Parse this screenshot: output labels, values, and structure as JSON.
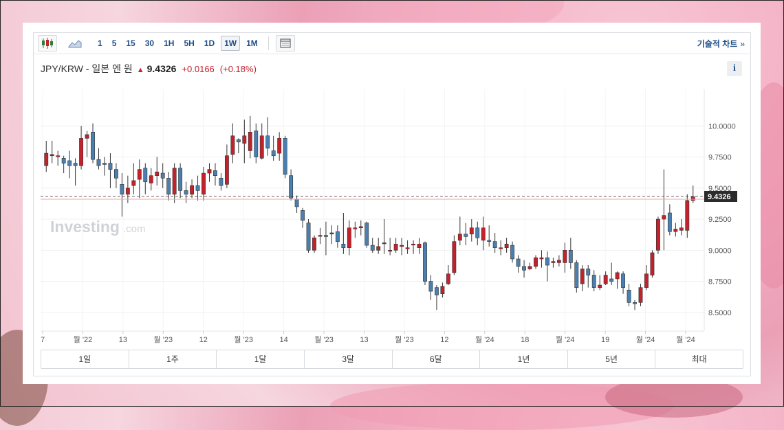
{
  "toolbar": {
    "timeframes": [
      "1",
      "5",
      "15",
      "30",
      "1H",
      "5H",
      "1D",
      "1W",
      "1M"
    ],
    "active_timeframe": "1W",
    "technical_chart_label": "기술적 차트",
    "technical_chart_chevron": "»",
    "icons": [
      "candlestick-icon",
      "area-chart-icon",
      "layout-icon"
    ]
  },
  "quote": {
    "name": "JPY/KRW - 일본 엔 원",
    "direction": "up",
    "price": "9.4326",
    "change": "+0.0166",
    "change_pct": "(+0.18%)"
  },
  "info_label": "i",
  "watermark": {
    "brand": "Investing",
    "suffix": ".com"
  },
  "ranges": [
    "1일",
    "1주",
    "1달",
    "3달",
    "6달",
    "1년",
    "5년",
    "최대"
  ],
  "colors": {
    "up": "#c3212b",
    "down": "#4a7fb0",
    "accent": "#1d4e89",
    "current_price_tag": "#2b2b2b"
  },
  "chart_data": {
    "type": "candlestick",
    "y_ticks": [
      "10.0000",
      "9.7500",
      "9.5000",
      "9.2500",
      "9.0000",
      "8.7500",
      "8.5000"
    ],
    "ylim": [
      8.35,
      10.25
    ],
    "current_price": "9.4326",
    "x_ticks": [
      "7",
      "월 '22",
      "13",
      "월 '23",
      "12",
      "월 '23",
      "14",
      "월 '23",
      "13",
      "월 '23",
      "12",
      "월 '24",
      "18",
      "월 '24",
      "19",
      "월 '24",
      "월 '24"
    ],
    "candles": [
      [
        9.68,
        9.78,
        9.88,
        9.63
      ],
      [
        9.76,
        9.77,
        9.88,
        9.7
      ],
      [
        9.76,
        9.76,
        9.8,
        9.68
      ],
      [
        9.74,
        9.7,
        9.76,
        9.62
      ],
      [
        9.72,
        9.68,
        9.8,
        9.58
      ],
      [
        9.7,
        9.68,
        9.74,
        9.52
      ],
      [
        9.68,
        9.9,
        10.0,
        9.65
      ],
      [
        9.9,
        9.93,
        9.96,
        9.75
      ],
      [
        9.95,
        9.73,
        10.02,
        9.7
      ],
      [
        9.73,
        9.68,
        9.82,
        9.65
      ],
      [
        9.7,
        9.69,
        9.75,
        9.6
      ],
      [
        9.7,
        9.65,
        9.78,
        9.5
      ],
      [
        9.65,
        9.58,
        9.7,
        9.5
      ],
      [
        9.53,
        9.45,
        9.62,
        9.27
      ],
      [
        9.45,
        9.5,
        9.6,
        9.38
      ],
      [
        9.52,
        9.56,
        9.7,
        9.45
      ],
      [
        9.57,
        9.65,
        9.73,
        9.42
      ],
      [
        9.66,
        9.55,
        9.7,
        9.45
      ],
      [
        9.54,
        9.6,
        9.66,
        9.48
      ],
      [
        9.6,
        9.63,
        9.75,
        9.52
      ],
      [
        9.62,
        9.58,
        9.7,
        9.5
      ],
      [
        9.58,
        9.45,
        9.63,
        9.4
      ],
      [
        9.45,
        9.66,
        9.7,
        9.38
      ],
      [
        9.66,
        9.48,
        9.7,
        9.42
      ],
      [
        9.48,
        9.45,
        9.55,
        9.38
      ],
      [
        9.45,
        9.52,
        9.57,
        9.42
      ],
      [
        9.52,
        9.48,
        9.6,
        9.4
      ],
      [
        9.45,
        9.62,
        9.67,
        9.4
      ],
      [
        9.62,
        9.65,
        9.7,
        9.55
      ],
      [
        9.64,
        9.6,
        9.7,
        9.52
      ],
      [
        9.58,
        9.52,
        9.62,
        9.48
      ],
      [
        9.53,
        9.76,
        9.85,
        9.5
      ],
      [
        9.77,
        9.92,
        10.02,
        9.7
      ],
      [
        9.89,
        9.87,
        9.9,
        9.78
      ],
      [
        9.86,
        9.92,
        10.05,
        9.7
      ],
      [
        9.8,
        9.95,
        10.08,
        9.74
      ],
      [
        9.96,
        9.75,
        10.02,
        9.7
      ],
      [
        9.74,
        9.92,
        10.02,
        9.73
      ],
      [
        9.92,
        9.82,
        10.07,
        9.76
      ],
      [
        9.8,
        9.76,
        9.92,
        9.72
      ],
      [
        9.78,
        9.9,
        9.95,
        9.72
      ],
      [
        9.9,
        9.61,
        9.92,
        9.58
      ],
      [
        9.6,
        9.42,
        9.65,
        9.4
      ],
      [
        9.41,
        9.35,
        9.44,
        9.3
      ],
      [
        9.32,
        9.24,
        9.34,
        9.18
      ],
      [
        9.22,
        9.0,
        9.25,
        8.98
      ],
      [
        9.0,
        9.1,
        9.12,
        8.98
      ],
      [
        9.12,
        9.12,
        9.18,
        9.05
      ],
      [
        9.12,
        9.11,
        9.23,
        8.96
      ],
      [
        9.13,
        9.14,
        9.2,
        9.05
      ],
      [
        9.15,
        9.07,
        9.2,
        9.02
      ],
      [
        9.05,
        9.02,
        9.3,
        8.97
      ],
      [
        9.02,
        9.18,
        9.24,
        8.96
      ],
      [
        9.18,
        9.18,
        9.23,
        9.1
      ],
      [
        9.18,
        9.19,
        9.24,
        9.12
      ],
      [
        9.22,
        9.04,
        9.23,
        9.02
      ],
      [
        9.04,
        9.0,
        9.1,
        8.98
      ],
      [
        9.0,
        9.03,
        9.1,
        8.97
      ],
      [
        9.06,
        9.06,
        9.25,
        8.97
      ],
      [
        9.0,
        9.0,
        9.1,
        8.96
      ],
      [
        9.0,
        9.05,
        9.1,
        8.98
      ],
      [
        9.03,
        9.04,
        9.1,
        8.96
      ],
      [
        9.02,
        9.02,
        9.08,
        8.97
      ],
      [
        9.05,
        9.05,
        9.08,
        8.97
      ],
      [
        9.02,
        9.05,
        9.1,
        8.97
      ],
      [
        9.06,
        8.75,
        9.07,
        8.72
      ],
      [
        8.75,
        8.67,
        8.8,
        8.6
      ],
      [
        8.7,
        8.64,
        8.72,
        8.52
      ],
      [
        8.65,
        8.71,
        8.74,
        8.62
      ],
      [
        8.73,
        8.81,
        8.88,
        8.72
      ],
      [
        8.82,
        9.07,
        9.12,
        8.8
      ],
      [
        9.08,
        9.13,
        9.27,
        9.04
      ],
      [
        9.13,
        9.11,
        9.22,
        9.04
      ],
      [
        9.13,
        9.18,
        9.25,
        9.07
      ],
      [
        9.18,
        9.1,
        9.23,
        9.04
      ],
      [
        9.08,
        9.18,
        9.27,
        9.0
      ],
      [
        9.08,
        9.07,
        9.2,
        9.03
      ],
      [
        9.07,
        9.02,
        9.14,
        8.98
      ],
      [
        9.02,
        9.02,
        9.08,
        8.96
      ],
      [
        9.02,
        9.05,
        9.1,
        8.98
      ],
      [
        9.04,
        8.93,
        9.07,
        8.9
      ],
      [
        8.93,
        8.87,
        8.96,
        8.82
      ],
      [
        8.87,
        8.84,
        8.92,
        8.78
      ],
      [
        8.85,
        8.87,
        8.9,
        8.84
      ],
      [
        8.87,
        8.94,
        8.96,
        8.85
      ],
      [
        8.93,
        8.94,
        9.0,
        8.86
      ],
      [
        8.94,
        8.88,
        8.99,
        8.75
      ],
      [
        8.9,
        8.91,
        8.94,
        8.86
      ],
      [
        8.9,
        8.92,
        8.96,
        8.87
      ],
      [
        8.9,
        9.0,
        9.06,
        8.82
      ],
      [
        9.0,
        8.9,
        9.1,
        8.85
      ],
      [
        8.9,
        8.7,
        8.92,
        8.66
      ],
      [
        8.73,
        8.85,
        8.88,
        8.67
      ],
      [
        8.85,
        8.8,
        8.88,
        8.7
      ],
      [
        8.8,
        8.7,
        8.84,
        8.67
      ],
      [
        8.7,
        8.72,
        8.8,
        8.68
      ],
      [
        8.73,
        8.8,
        8.83,
        8.72
      ],
      [
        8.77,
        8.75,
        8.9,
        8.72
      ],
      [
        8.77,
        8.82,
        8.83,
        8.69
      ],
      [
        8.81,
        8.7,
        8.83,
        8.65
      ],
      [
        8.68,
        8.58,
        8.73,
        8.55
      ],
      [
        8.58,
        8.57,
        8.6,
        8.52
      ],
      [
        8.58,
        8.7,
        8.73,
        8.55
      ],
      [
        8.7,
        8.81,
        8.88,
        8.68
      ],
      [
        8.8,
        8.98,
        9.0,
        8.78
      ],
      [
        9.0,
        9.25,
        9.27,
        8.97
      ],
      [
        9.25,
        9.28,
        9.65,
        9.0
      ],
      [
        9.3,
        9.15,
        9.37,
        9.12
      ],
      [
        9.15,
        9.17,
        9.22,
        9.11
      ],
      [
        9.16,
        9.18,
        9.25,
        9.12
      ],
      [
        9.16,
        9.4,
        9.45,
        9.1
      ],
      [
        9.4,
        9.43,
        9.52,
        9.38
      ]
    ]
  }
}
